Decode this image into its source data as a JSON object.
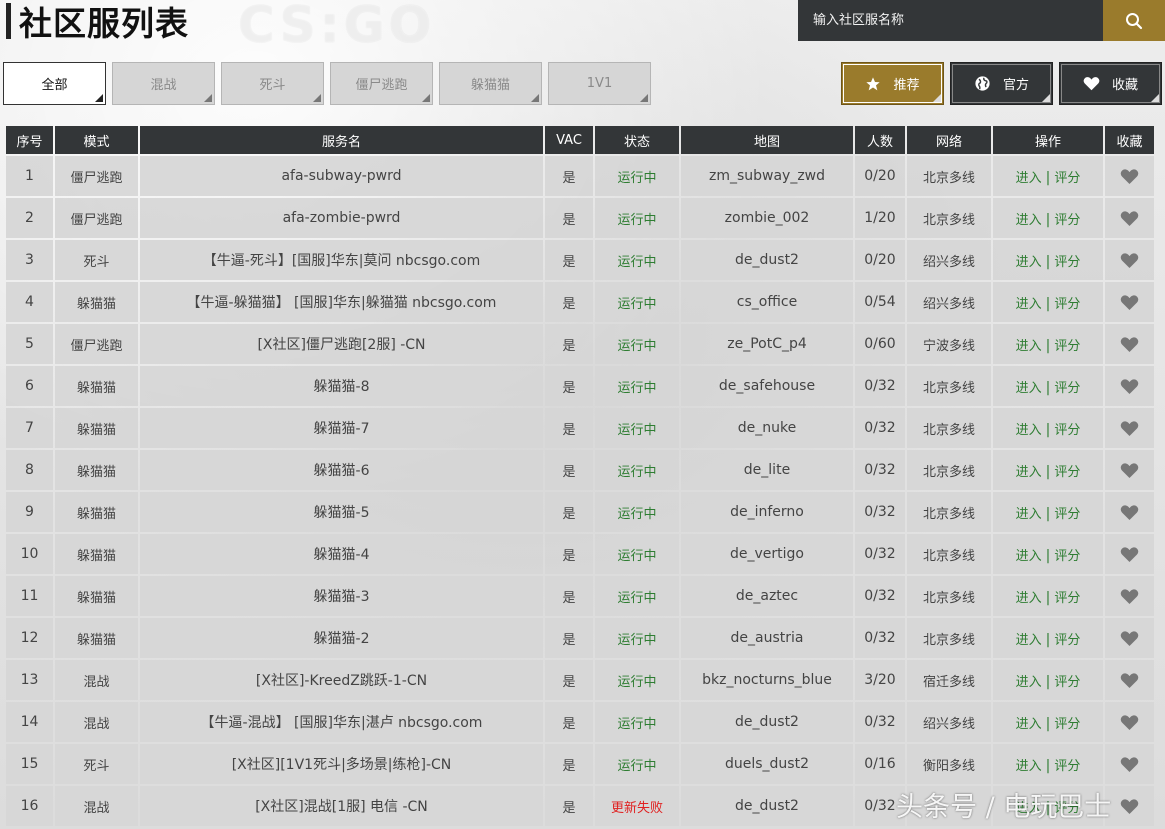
{
  "header": {
    "title": "社区服列表",
    "logo_text": "CS:GO",
    "search_placeholder": "输入社区服名称"
  },
  "mode_tabs": [
    {
      "label": "全部",
      "active": true
    },
    {
      "label": "混战",
      "active": false
    },
    {
      "label": "死斗",
      "active": false
    },
    {
      "label": "僵尸逃跑",
      "active": false
    },
    {
      "label": "躲猫猫",
      "active": false
    },
    {
      "label": "1V1",
      "active": false
    }
  ],
  "filter_buttons": [
    {
      "label": "推荐",
      "icon": "star-icon",
      "style": "gold"
    },
    {
      "label": "官方",
      "icon": "globe-icon",
      "style": "dark"
    },
    {
      "label": "收藏",
      "icon": "heart-icon",
      "style": "dark"
    }
  ],
  "table": {
    "headers": [
      "序号",
      "模式",
      "服务名",
      "VAC",
      "状态",
      "地图",
      "人数",
      "网络",
      "操作",
      "收藏"
    ],
    "join_label": "进入",
    "rate_label": "评分",
    "separator": "|",
    "rows": [
      {
        "no": "1",
        "mode": "僵尸逃跑",
        "name": "afa-subway-pwrd",
        "vac": "是",
        "status": "运行中",
        "map": "zm_subway_zwd",
        "players": "0/20",
        "network": "北京多线"
      },
      {
        "no": "2",
        "mode": "僵尸逃跑",
        "name": "afa-zombie-pwrd",
        "vac": "是",
        "status": "运行中",
        "map": "zombie_002",
        "players": "1/20",
        "network": "北京多线"
      },
      {
        "no": "3",
        "mode": "死斗",
        "name": "【牛逼-死斗】[国服]华东|莫问 nbcsgo.com",
        "vac": "是",
        "status": "运行中",
        "map": "de_dust2",
        "players": "0/20",
        "network": "绍兴多线"
      },
      {
        "no": "4",
        "mode": "躲猫猫",
        "name": "【牛逼-躲猫猫】 [国服]华东|躲猫猫 nbcsgo.com",
        "vac": "是",
        "status": "运行中",
        "map": "cs_office",
        "players": "0/54",
        "network": "绍兴多线"
      },
      {
        "no": "5",
        "mode": "僵尸逃跑",
        "name": "[X社区]僵尸逃跑[2服] -CN",
        "vac": "是",
        "status": "运行中",
        "map": "ze_PotC_p4",
        "players": "0/60",
        "network": "宁波多线"
      },
      {
        "no": "6",
        "mode": "躲猫猫",
        "name": "躲猫猫-8",
        "vac": "是",
        "status": "运行中",
        "map": "de_safehouse",
        "players": "0/32",
        "network": "北京多线"
      },
      {
        "no": "7",
        "mode": "躲猫猫",
        "name": "躲猫猫-7",
        "vac": "是",
        "status": "运行中",
        "map": "de_nuke",
        "players": "0/32",
        "network": "北京多线"
      },
      {
        "no": "8",
        "mode": "躲猫猫",
        "name": "躲猫猫-6",
        "vac": "是",
        "status": "运行中",
        "map": "de_lite",
        "players": "0/32",
        "network": "北京多线"
      },
      {
        "no": "9",
        "mode": "躲猫猫",
        "name": "躲猫猫-5",
        "vac": "是",
        "status": "运行中",
        "map": "de_inferno",
        "players": "0/32",
        "network": "北京多线"
      },
      {
        "no": "10",
        "mode": "躲猫猫",
        "name": "躲猫猫-4",
        "vac": "是",
        "status": "运行中",
        "map": "de_vertigo",
        "players": "0/32",
        "network": "北京多线"
      },
      {
        "no": "11",
        "mode": "躲猫猫",
        "name": "躲猫猫-3",
        "vac": "是",
        "status": "运行中",
        "map": "de_aztec",
        "players": "0/32",
        "network": "北京多线"
      },
      {
        "no": "12",
        "mode": "躲猫猫",
        "name": "躲猫猫-2",
        "vac": "是",
        "status": "运行中",
        "map": "de_austria",
        "players": "0/32",
        "network": "北京多线"
      },
      {
        "no": "13",
        "mode": "混战",
        "name": "[X社区]-KreedZ跳跃-1-CN",
        "vac": "是",
        "status": "运行中",
        "map": "bkz_nocturns_blue",
        "players": "3/20",
        "network": "宿迁多线"
      },
      {
        "no": "14",
        "mode": "混战",
        "name": "【牛逼-混战】 [国服]华东|湛卢 nbcsgo.com",
        "vac": "是",
        "status": "运行中",
        "map": "de_dust2",
        "players": "0/32",
        "network": "绍兴多线"
      },
      {
        "no": "15",
        "mode": "死斗",
        "name": "[X社区][1V1死斗|多场景|练枪]-CN",
        "vac": "是",
        "status": "运行中",
        "map": "duels_dust2",
        "players": "0/16",
        "network": "衡阳多线"
      },
      {
        "no": "16",
        "mode": "混战",
        "name": "[X社区]混战[1服] 电信 -CN",
        "vac": "是",
        "status": "更新失败",
        "map": "de_dust2",
        "players": "0/32",
        "network": "",
        "status_fail": true
      }
    ]
  },
  "watermark": "头条号 / 电玩巴士",
  "colors": {
    "gold": "#9a7b2c",
    "dark": "#333638",
    "status_ok": "#2e7d32",
    "status_fail": "#e02020"
  }
}
